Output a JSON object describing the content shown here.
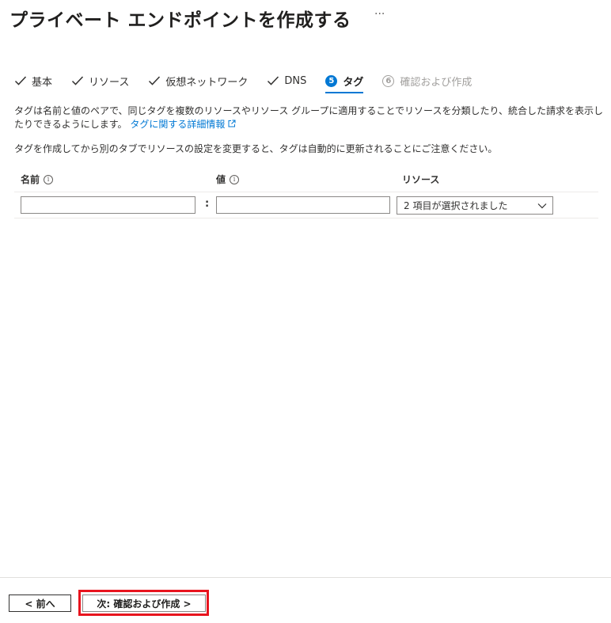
{
  "page": {
    "title": "プライベート エンドポイントを作成する",
    "more": "···"
  },
  "tabs": [
    {
      "label": "基本",
      "state": "completed"
    },
    {
      "label": "リソース",
      "state": "completed"
    },
    {
      "label": "仮想ネットワーク",
      "state": "completed"
    },
    {
      "label": "DNS",
      "state": "completed"
    },
    {
      "label": "タグ",
      "number": "5",
      "state": "active"
    },
    {
      "label": "確認および作成",
      "number": "6",
      "state": "disabled"
    }
  ],
  "description": {
    "text": "タグは名前と値のペアで、同じタグを複数のリソースやリソース グループに適用することでリソースを分類したり、統合した請求を表示したりできるようにします。",
    "link": "タグに関する詳細情報",
    "note": "タグを作成してから別のタブでリソースの設定を変更すると、タグは自動的に更新されることにご注意ください。"
  },
  "table": {
    "headers": {
      "name": "名前",
      "value": "値",
      "resource": "リソース"
    },
    "separator": ":",
    "row": {
      "name_value": "",
      "value_value": "",
      "resource_selected": "2 項目が選択されました"
    }
  },
  "footer": {
    "prev_label": "< 前へ",
    "next_label": "次: 確認および作成 >",
    "highlight_color": "#e8141e"
  },
  "colors": {
    "accent": "#0078d4",
    "text": "#323130",
    "disabled": "#a19f9d"
  }
}
